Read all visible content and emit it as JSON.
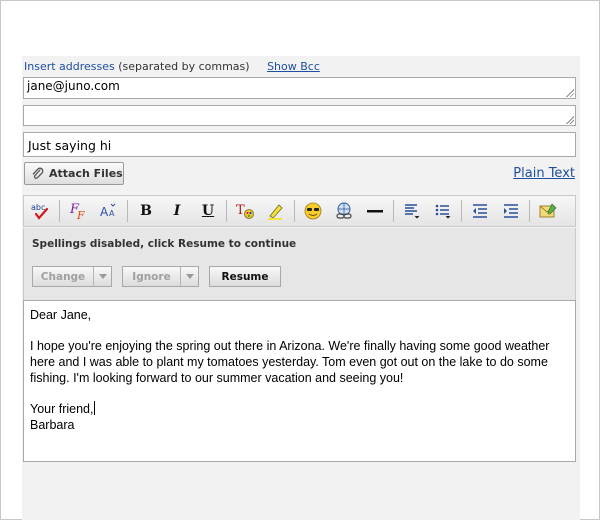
{
  "recipients": {
    "insert_label": "Insert addresses",
    "separator_hint": "(separated by commas)",
    "show_bcc": "Show Bcc",
    "to_value": "jane@juno.com",
    "cc_value": ""
  },
  "subject": {
    "value": "Just saying hi"
  },
  "attach": {
    "label": "Attach Files",
    "icon": "paperclip-icon"
  },
  "plain_text_link": "Plain Text",
  "toolbar": {
    "spell_text": "abc",
    "bold": "B",
    "italic": "I",
    "underline": "U"
  },
  "spell": {
    "message": "Spellings disabled, click Resume to continue",
    "change_label": "Change",
    "ignore_label": "Ignore",
    "resume_label": "Resume"
  },
  "message": {
    "greeting": "Dear Jane,",
    "paragraph_1": "I hope you're enjoying the spring out there in Arizona.  We're finally having some good weather here and I was able to plant my tomatoes yesterday.  Tom even got out on the lake to do some fishing. I'm looking forward to our summer vacation and seeing you!",
    "closing": "Your friend,",
    "signature": "Barbara"
  },
  "colors": {
    "link": "#1f4fa0",
    "panel": "#f2f2f2",
    "toolbar": "#e4e4e4"
  }
}
